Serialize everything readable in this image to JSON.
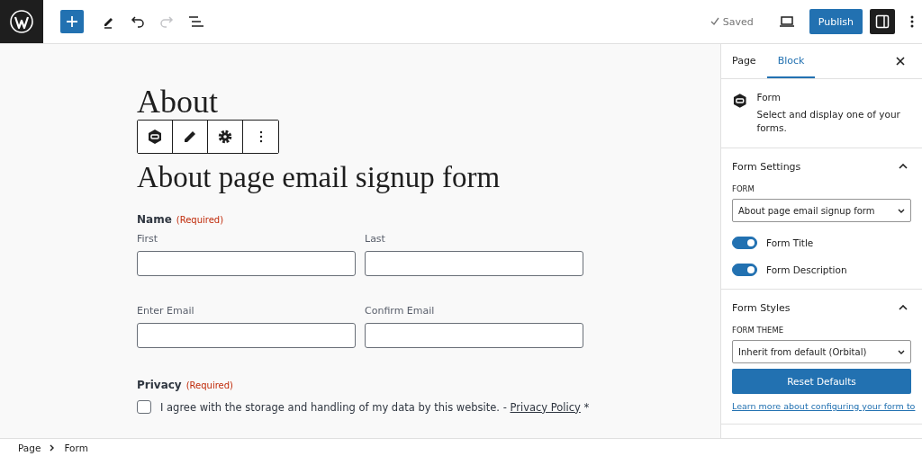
{
  "toolbar": {
    "saved": "Saved",
    "publish": "Publish",
    "redo_disabled": true,
    "sidebar_toggle_on": true
  },
  "canvas": {
    "page_title": "About",
    "form_title": "About page email signup form",
    "name_field": {
      "label": "Name",
      "required": "(Required)",
      "sub": [
        {
          "label": "First"
        },
        {
          "label": "Last"
        }
      ]
    },
    "email_fields": [
      {
        "label": "Enter Email"
      },
      {
        "label": "Confirm Email"
      }
    ],
    "privacy": {
      "label": "Privacy",
      "required": "(Required)",
      "checked": false,
      "text": "I agree with the storage and handling of my data by this website. -",
      "link": "Privacy Policy",
      "mark": "*"
    }
  },
  "sidebar": {
    "tabs": [
      {
        "label": "Page",
        "selected": false
      },
      {
        "label": "Block",
        "selected": true
      }
    ],
    "block": {
      "name": "Form",
      "description": "Select and display one of your forms."
    },
    "panels": [
      {
        "title": "Form Settings",
        "expanded": true,
        "select_label": "FORM",
        "select_value": "About page email signup form",
        "toggles": [
          {
            "label": "Form Title",
            "on": true
          },
          {
            "label": "Form Description",
            "on": true
          }
        ]
      },
      {
        "title": "Form Styles",
        "expanded": true,
        "select_label": "FORM THEME",
        "select_value": "Inherit from default (Orbital)",
        "button": "Reset Defaults",
        "link": "Learn more about configuring your form to"
      }
    ]
  },
  "breadcrumb": [
    "Page",
    "Form"
  ]
}
